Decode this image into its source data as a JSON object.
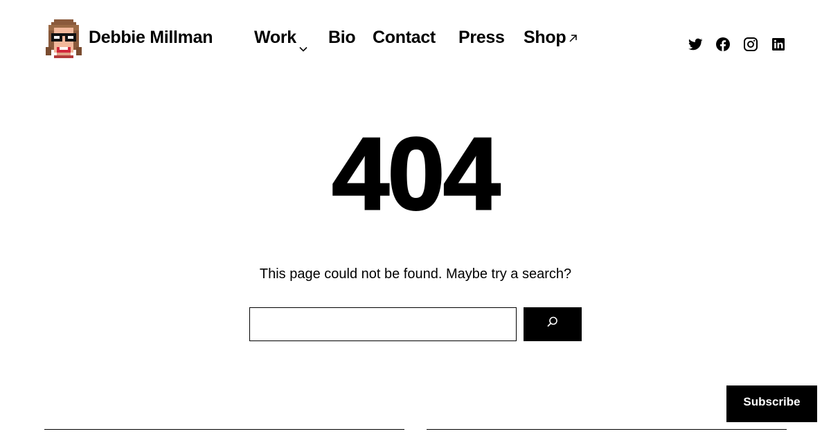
{
  "header": {
    "site_title": "Debbie Millman",
    "nav": {
      "work": "Work",
      "bio": "Bio",
      "contact": "Contact",
      "press": "Press",
      "shop": "Shop"
    },
    "social_icons": [
      "twitter-icon",
      "facebook-icon",
      "instagram-icon",
      "linkedin-icon"
    ]
  },
  "main": {
    "error_code": "404",
    "message": "This page could not be found. Maybe try a search?",
    "search": {
      "value": "",
      "placeholder": ""
    }
  },
  "subscribe_label": "Subscribe",
  "colors": {
    "text": "#000000",
    "background": "#ffffff",
    "button": "#000000"
  }
}
